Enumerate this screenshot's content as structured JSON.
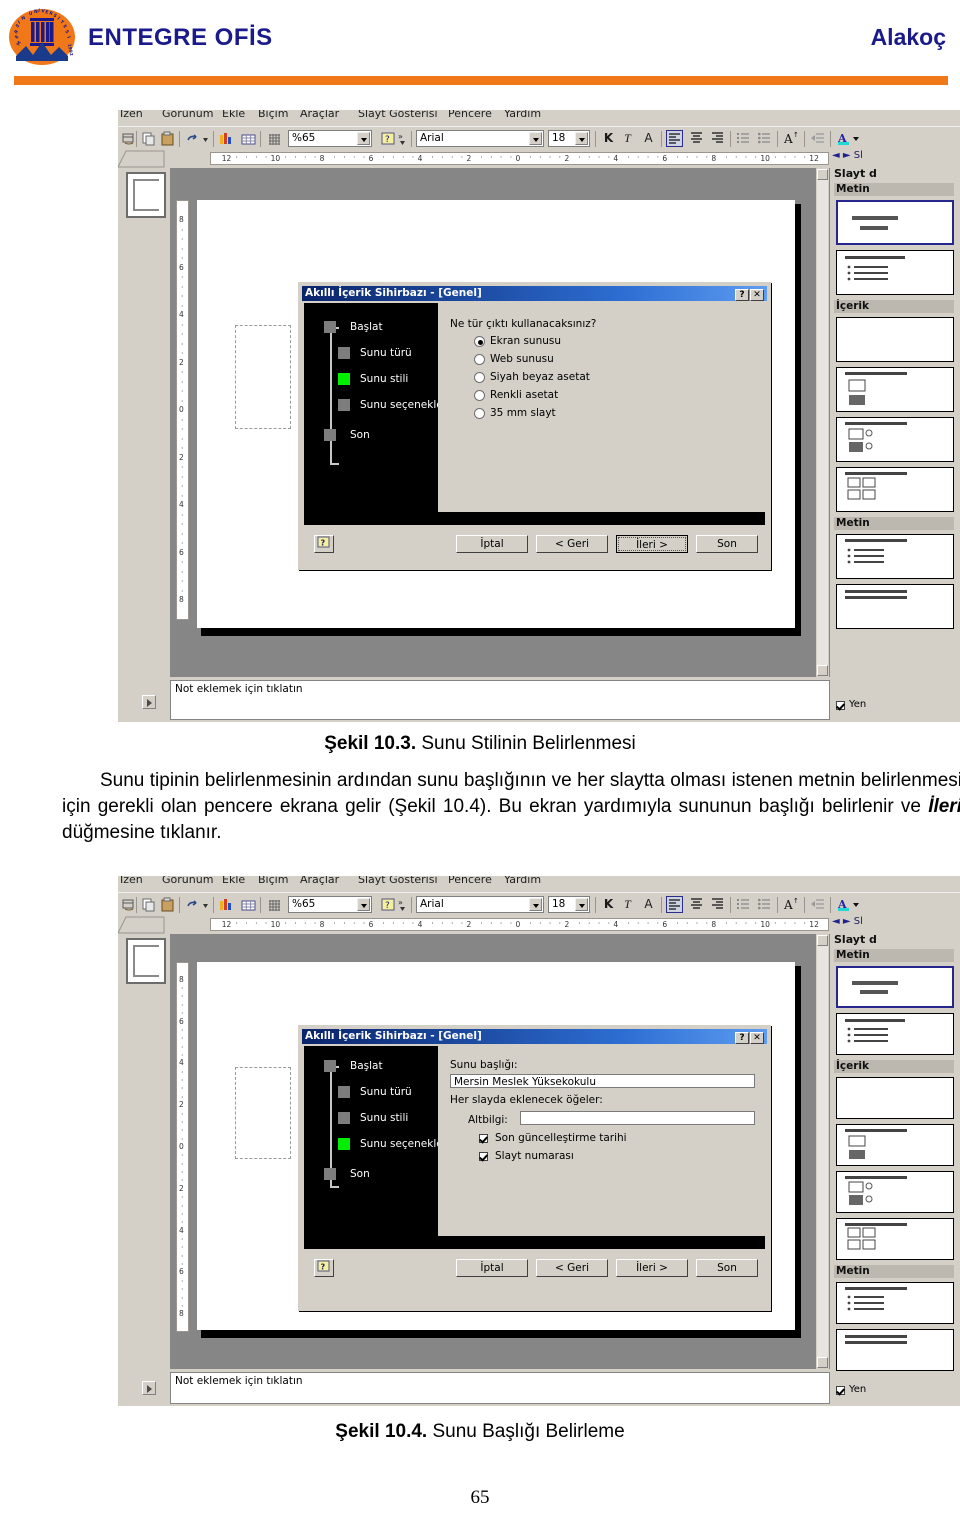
{
  "header": {
    "logo_alt": "Mersin Üniversitesi 1992",
    "title": "ENTEGRE OFİS",
    "author": "Alakoç",
    "accent_color": "#F07818",
    "title_color": "#1a1a8c"
  },
  "app": {
    "menus": [
      "İzen",
      "Görünüm",
      "Ekle",
      "Biçim",
      "Araçlar",
      "Slayt Gösterisi",
      "Pencere",
      "Yardım"
    ],
    "toolbar": {
      "zoom_value": "%65",
      "font_name": "Arial",
      "font_size": "18",
      "icons": [
        "print-preview-icon",
        "copy-icon",
        "paste-icon",
        "undo-icon",
        "undo-dropdown-icon",
        "insert-chart-icon",
        "insert-table-icon",
        "grid-icon",
        "help-icon",
        "toolbar-overflow-icon"
      ],
      "format_buttons": [
        "K",
        "T",
        "A"
      ],
      "format_icons": [
        "align-left-icon",
        "align-center-icon",
        "align-right-icon",
        "numbered-list-icon",
        "bulleted-list-icon",
        "increase-font-size-icon",
        "decrease-indent-icon",
        "font-color-icon",
        "font-color-dropdown-icon"
      ]
    },
    "ruler_h_ticks": [
      "12",
      "10",
      "8",
      "6",
      "4",
      "2",
      "0",
      "2",
      "4",
      "6",
      "8",
      "10",
      "12"
    ],
    "ruler_v_ticks": [
      "8",
      "6",
      "4",
      "2",
      "0",
      "2",
      "4",
      "6",
      "8"
    ],
    "notes_placeholder": "Not eklemek için tıklatın",
    "outline_close": "✕"
  },
  "taskpane": {
    "nav_back_icon": "back-arrow-icon",
    "nav_forward_icon": "forward-arrow-icon",
    "nav_home_label": "Sl",
    "title": "Slayt d",
    "sections": [
      "Metin",
      "İçerik",
      "Metin"
    ],
    "checkbox_label": "Yen",
    "checkbox_checked": true
  },
  "figures": [
    {
      "id": "sekil-10-3",
      "caption_number": "Şekil 10.3.",
      "caption_text": " Sunu Stilinin Belirlenmesi",
      "dialog": {
        "title": "Akıllı İçerik Sihirbazı - [Genel]",
        "help_btn": "?",
        "close_btn": "✕",
        "steps": [
          "Başlat",
          "Sunu türü",
          "Sunu stili",
          "Sunu seçenekleri",
          "Son"
        ],
        "active_step_index": 2,
        "question": "Ne tür çıktı kullanacaksınız?",
        "options": [
          "Ekran sunusu",
          "Web sunusu",
          "Siyah beyaz asetat",
          "Renkli asetat",
          "35 mm slayt"
        ],
        "selected_option_index": 0,
        "buttons": [
          "İptal",
          "< Geri",
          "İleri >",
          "Son"
        ],
        "default_button_index": 2,
        "help_button": "?"
      }
    },
    {
      "id": "sekil-10-4",
      "caption_number": "Şekil 10.4.",
      "caption_text": " Sunu Başlığı Belirleme",
      "dialog": {
        "title": "Akıllı İçerik Sihirbazı - [Genel]",
        "help_btn": "?",
        "close_btn": "✕",
        "steps": [
          "Başlat",
          "Sunu türü",
          "Sunu stili",
          "Sunu seçenekleri",
          "Son"
        ],
        "active_step_index": 3,
        "title_label": "Sunu başlığı:",
        "title_value": "Mersin Meslek Yüksekokulu",
        "items_label": "Her slayda eklenecek öğeler:",
        "footer_label": "Altbilgi:",
        "footer_value": "",
        "checks": [
          {
            "label": "Son güncelleştirme tarihi",
            "checked": true
          },
          {
            "label": "Slayt numarası",
            "checked": true
          }
        ],
        "buttons": [
          "İptal",
          "< Geri",
          "İleri >",
          "Son"
        ],
        "default_button_index": -1,
        "help_button": "?"
      }
    }
  ],
  "body": {
    "paragraph_line1": "Sunu tipinin belirlenmesinin ardından sunu başlığının ve her slaytta olması",
    "paragraph_line2": "istenen metnin belirlenmesi için gerekli olan pencere ekrana gelir (Şekil 10.4). Bu",
    "paragraph_line3_a": "ekran yardımıyla sununun başlığı belirlenir ve ",
    "paragraph_line3_em": "İleri",
    "paragraph_line3_b": " düğmesine tıklanır."
  },
  "footer": {
    "page_number": "65"
  }
}
